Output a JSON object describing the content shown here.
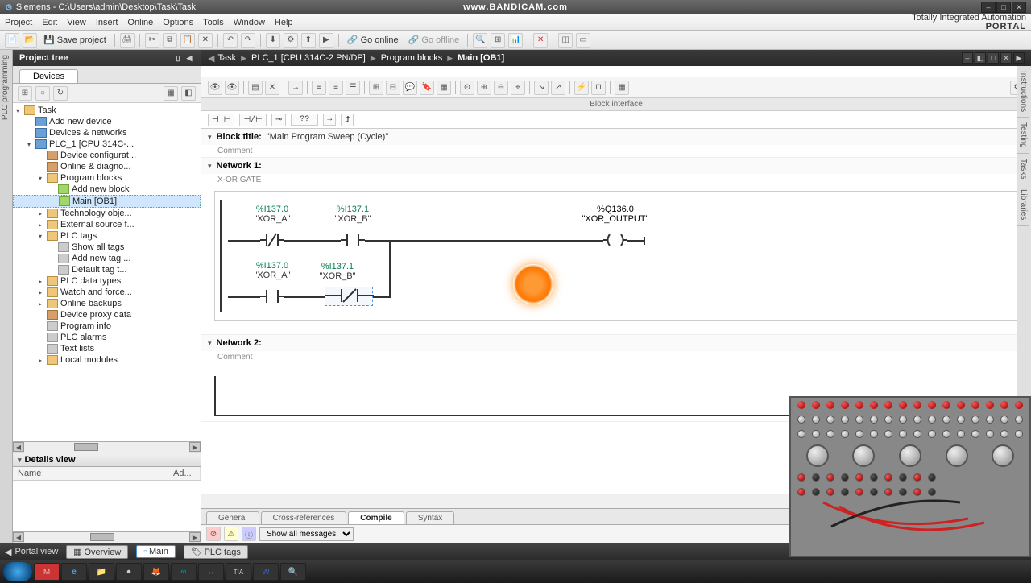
{
  "titlebar": {
    "app": "Siemens",
    "path": "C:\\Users\\admin\\Desktop\\Task\\Task",
    "watermark": "www.BANDICAM.com"
  },
  "menubar": {
    "items": [
      "Project",
      "Edit",
      "View",
      "Insert",
      "Online",
      "Options",
      "Tools",
      "Window",
      "Help"
    ],
    "brand_line1": "Totally Integrated Automation",
    "brand_line2": "PORTAL"
  },
  "toolbar": {
    "save": "Save project",
    "go_online": "Go online",
    "go_offline": "Go offline"
  },
  "project_tree": {
    "title": "Project tree",
    "tab": "Devices",
    "side_label": "PLC programming",
    "nodes": [
      {
        "ind": 0,
        "exp": "▾",
        "icon": "ti-folder",
        "label": "Task"
      },
      {
        "ind": 1,
        "exp": "",
        "icon": "ti-dev",
        "label": "Add new device"
      },
      {
        "ind": 1,
        "exp": "",
        "icon": "ti-dev",
        "label": "Devices & networks"
      },
      {
        "ind": 1,
        "exp": "▾",
        "icon": "ti-dev",
        "label": "PLC_1 [CPU 314C-..."
      },
      {
        "ind": 2,
        "exp": "",
        "icon": "ti-cfg",
        "label": "Device configurat..."
      },
      {
        "ind": 2,
        "exp": "",
        "icon": "ti-cfg",
        "label": "Online & diagno..."
      },
      {
        "ind": 2,
        "exp": "▾",
        "icon": "ti-folder",
        "label": "Program blocks"
      },
      {
        "ind": 3,
        "exp": "",
        "icon": "ti-block",
        "label": "Add new block"
      },
      {
        "ind": 3,
        "exp": "",
        "icon": "ti-block",
        "label": "Main [OB1]",
        "sel": true
      },
      {
        "ind": 2,
        "exp": "▸",
        "icon": "ti-folder",
        "label": "Technology obje..."
      },
      {
        "ind": 2,
        "exp": "▸",
        "icon": "ti-folder",
        "label": "External source f..."
      },
      {
        "ind": 2,
        "exp": "▾",
        "icon": "ti-folder",
        "label": "PLC tags"
      },
      {
        "ind": 3,
        "exp": "",
        "icon": "ti-obj",
        "label": "Show all tags"
      },
      {
        "ind": 3,
        "exp": "",
        "icon": "ti-obj",
        "label": "Add new tag ..."
      },
      {
        "ind": 3,
        "exp": "",
        "icon": "ti-obj",
        "label": "Default tag t..."
      },
      {
        "ind": 2,
        "exp": "▸",
        "icon": "ti-folder",
        "label": "PLC data types"
      },
      {
        "ind": 2,
        "exp": "▸",
        "icon": "ti-folder",
        "label": "Watch and force..."
      },
      {
        "ind": 2,
        "exp": "▸",
        "icon": "ti-folder",
        "label": "Online backups"
      },
      {
        "ind": 2,
        "exp": "",
        "icon": "ti-cfg",
        "label": "Device proxy data"
      },
      {
        "ind": 2,
        "exp": "",
        "icon": "ti-obj",
        "label": "Program info"
      },
      {
        "ind": 2,
        "exp": "",
        "icon": "ti-obj",
        "label": "PLC alarms"
      },
      {
        "ind": 2,
        "exp": "",
        "icon": "ti-obj",
        "label": "Text lists"
      },
      {
        "ind": 2,
        "exp": "▸",
        "icon": "ti-folder",
        "label": "Local modules"
      }
    ]
  },
  "details": {
    "title": "Details view",
    "col1": "Name",
    "col2": "Ad..."
  },
  "breadcrumb": {
    "items": [
      "Task",
      "PLC_1 [CPU 314C-2 PN/DP]",
      "Program blocks",
      "Main [OB1]"
    ]
  },
  "block_if": "Block interface",
  "lad_btns": [
    "⊣ ⊢",
    "⊣/⊢",
    "⊸",
    "−??−",
    "→",
    "⮥"
  ],
  "block_title": {
    "label": "Block title:",
    "value": "\"Main Program Sweep (Cycle)\"",
    "comment": "Comment"
  },
  "network1": {
    "title": "Network 1:",
    "subtitle": "X-OR GATE",
    "c1_addr": "%I137.0",
    "c1_name": "\"XOR_A\"",
    "c2_addr": "%I137.1",
    "c2_name": "\"XOR_B\"",
    "out_addr": "%Q136.0",
    "out_name": "\"XOR_OUTPUT\"",
    "c3_addr": "%I137.0",
    "c3_name": "\"XOR_A\"",
    "c4_addr": "%I137.1",
    "c4_name": "\"XOR_B\""
  },
  "network2": {
    "title": "Network 2:",
    "comment": "Comment"
  },
  "bottom_tabs": [
    "General",
    "Cross-references",
    "Compile",
    "Syntax"
  ],
  "bottom_active": 2,
  "msg_filter": "Show all messages",
  "status": {
    "portal": "Portal view",
    "tabs": [
      "Overview",
      "Main",
      "PLC tags"
    ]
  },
  "side_tabs": [
    "Instructions",
    "Testing",
    "Tasks",
    "Libraries"
  ]
}
